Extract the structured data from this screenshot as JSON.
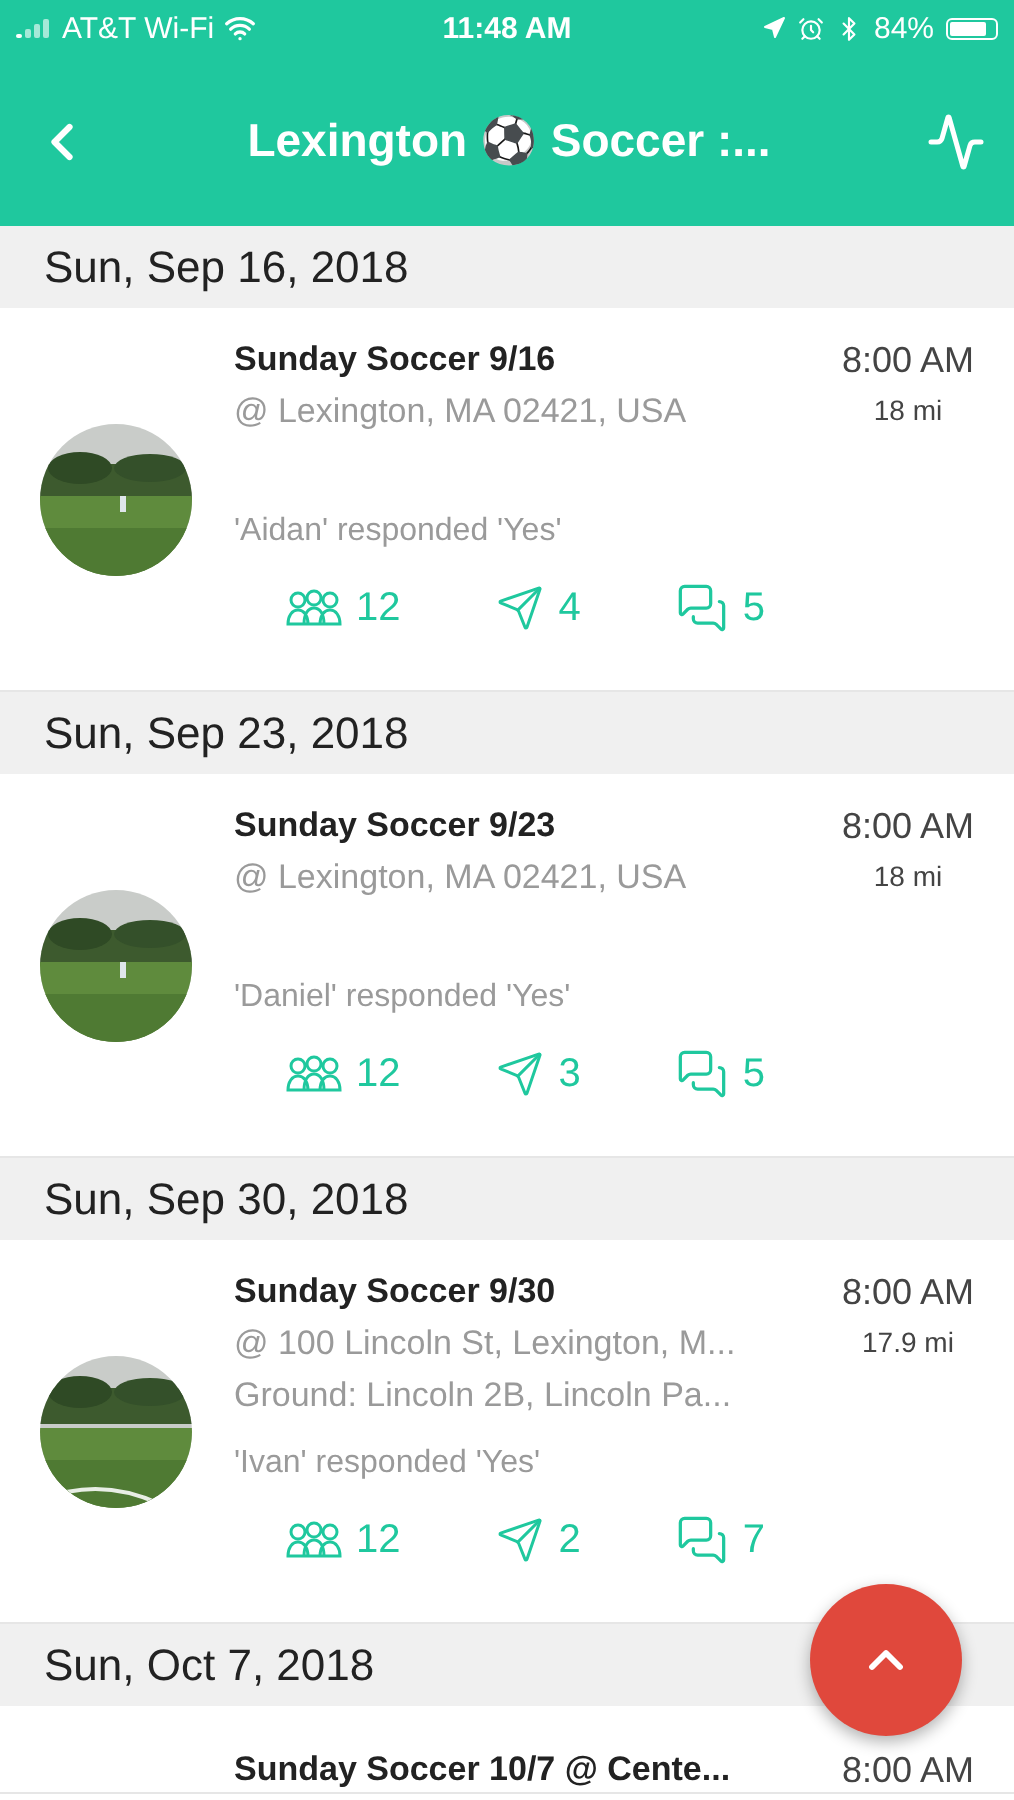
{
  "status_bar": {
    "carrier": "AT&T Wi-Fi",
    "time": "11:48 AM",
    "battery": "84%"
  },
  "nav": {
    "title": "Lexington ⚽ Soccer :..."
  },
  "events": [
    {
      "date": "Sun, Sep 16, 2018",
      "title": "Sunday Soccer 9/16",
      "location": "@ Lexington, MA 02421, USA",
      "response": "'Aidan' responded 'Yes'",
      "time": "8:00 AM",
      "distance": "18 mi",
      "attendees": "12",
      "sent": "4",
      "comments": "5"
    },
    {
      "date": "Sun, Sep 23, 2018",
      "title": "Sunday Soccer 9/23",
      "location": "@ Lexington, MA 02421, USA",
      "response": "'Daniel' responded 'Yes'",
      "time": "8:00 AM",
      "distance": "18 mi",
      "attendees": "12",
      "sent": "3",
      "comments": "5"
    },
    {
      "date": "Sun, Sep 30, 2018",
      "title": "Sunday Soccer 9/30",
      "location": "@ 100 Lincoln St, Lexington, M...",
      "ground": "Ground: Lincoln 2B, Lincoln Pa...",
      "response": "'Ivan' responded 'Yes'",
      "time": "8:00 AM",
      "distance": "17.9 mi",
      "attendees": "12",
      "sent": "2",
      "comments": "7"
    },
    {
      "date": "Sun, Oct 7, 2018",
      "title": "Sunday Soccer 10/7 @ Cente...",
      "time": "8:00 AM"
    }
  ]
}
